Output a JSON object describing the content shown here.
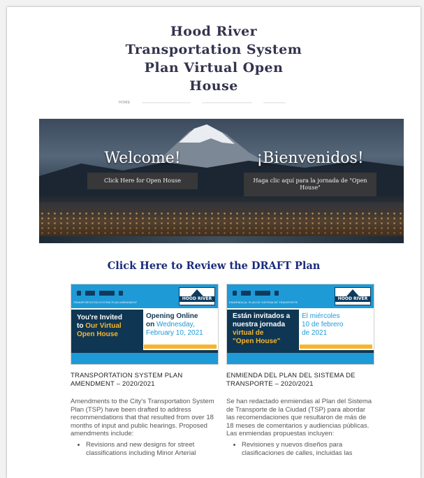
{
  "site": {
    "title_lines": [
      "Hood River",
      "Transportation System",
      "Plan Virtual Open",
      "House"
    ]
  },
  "nav": {
    "items": [
      "HOME"
    ]
  },
  "hero": {
    "left_heading": "Welcome!",
    "left_button": "Click Here for Open House",
    "right_heading": "¡Bienvenidos!",
    "right_button": "Haga clic aquí para la jornada de \"Open House\""
  },
  "draft_link": "Click Here to Review the DRAFT Plan",
  "cards": {
    "en": {
      "flyer_sub": "TRANSPORTATION SYSTEM PLAN AMENDMENT",
      "logo": "HOOD RIVER",
      "invite_l1": "You're Invited",
      "invite_l2a": "to ",
      "invite_l2b": "Our Virtual",
      "invite_l3": "Open House",
      "open_l1": "Opening Online",
      "open_l2a": "on ",
      "open_l2b": "Wednesday,",
      "open_l3": "February 10, 2021",
      "title": "TRANSPORTATION SYSTEM PLAN AMENDMENT – 2020/2021",
      "body": "Amendments to the City's Transportation System Plan (TSP) have been drafted to address recommendations that that resulted from over 18 months of input and public hearings.  Proposed amendments include:",
      "bullet1": "Revisions and new designs for street classifications including Minor Arterial"
    },
    "es": {
      "flyer_sub": "ENMIENDA AL PLAN DE SISTEMA DE TRANSPORTE",
      "logo": "HOOD RIVER",
      "invite_l1": "Están invitados a",
      "invite_l2": "nuestra jornada",
      "invite_l3": "virtual de",
      "invite_l4": "\"Open House\"",
      "open_l1": "El miércoles",
      "open_l2": "10 de febrero",
      "open_l3": "de 2021",
      "title": "ENMIENDA DEL PLAN DEL SISTEMA DE TRANSPORTE – 2020/2021",
      "body": "Se han redactado enmiendas al Plan del Sistema de Transporte de la Ciudad (TSP) para abordar las recomendaciones que resultaron de más de 18 meses de comentarios y audiencias públicas.  Las enmiendas propuestas incluyen:",
      "bullet1": "Revisiones y nuevos diseños para clasificaciones de calles, incluidas las"
    }
  },
  "colors": {
    "title": "#33334d",
    "link": "#1a2a7a",
    "flyer_blue": "#1e9ad6",
    "flyer_navy": "#0f3652",
    "flyer_yellow": "#f7b52c"
  }
}
